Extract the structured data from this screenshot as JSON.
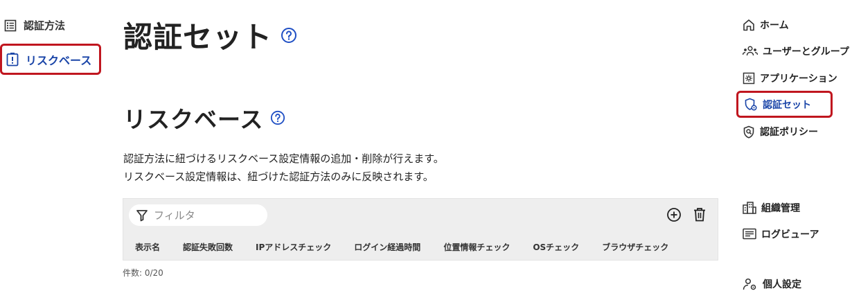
{
  "left_nav": {
    "items": [
      {
        "label": "認証方法",
        "icon": "list-icon"
      },
      {
        "label": "リスクベース",
        "icon": "alert-card-icon",
        "active": true
      }
    ]
  },
  "main": {
    "page_title": "認証セット",
    "section_title": "リスクベース",
    "description": [
      "認証方法に紐づけるリスクベース設定情報の追加・削除が行えます。",
      "リスクベース設定情報は、紐づけた認証方法のみに反映されます。"
    ],
    "filter_placeholder": "フィルタ",
    "columns": [
      "表示名",
      "認証失敗回数",
      "IPアドレスチェック",
      "ログイン経過時間",
      "位置情報チェック",
      "OSチェック",
      "ブラウザチェック"
    ],
    "count": "件数: 0/20"
  },
  "right_nav": {
    "items": [
      {
        "label": "ホーム",
        "icon": "home-icon"
      },
      {
        "label": "ユーザーとグループ",
        "icon": "users-icon"
      },
      {
        "label": "アプリケーション",
        "icon": "app-icon"
      },
      {
        "label": "認証セット",
        "icon": "shield-gear-icon",
        "active": true
      },
      {
        "label": "認証ポリシー",
        "icon": "shield-search-icon"
      },
      {
        "label": "組織管理",
        "icon": "building-icon"
      },
      {
        "label": "ログビューア",
        "icon": "log-icon"
      },
      {
        "label": "個人設定",
        "icon": "person-gear-icon"
      }
    ]
  },
  "colors": {
    "active": "#1a45a8",
    "highlight_border": "#c0161f",
    "help_icon": "#1f4fc4"
  }
}
